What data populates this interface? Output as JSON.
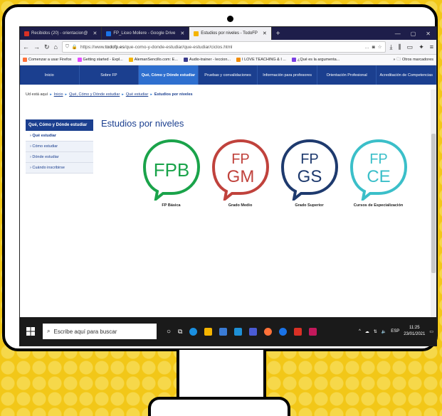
{
  "browser": {
    "tabs": [
      {
        "title": "Recibidos (20) - orientacion@",
        "color": "#d93025",
        "active": false
      },
      {
        "title": "FP_Liceo Moliere - Google Drive",
        "color": "#1a73e8",
        "active": false
      },
      {
        "title": "Estudios por niveles - TodoFP",
        "color": "#f4b400",
        "active": true
      }
    ],
    "new_tab": "+",
    "url_prefix": "https://www.",
    "url_domain": "todofp.es",
    "url_path": "/que-como-y-donde-estudiar/que-estudiar/ciclos.html",
    "url_menu": "…",
    "bookmarks": [
      {
        "label": "Comenzar a usar Firefox",
        "color": "#ff7139"
      },
      {
        "label": "Getting started - Expl...",
        "color": "#e44dff"
      },
      {
        "label": "AlemanSencillo.com: E...",
        "color": "#f4b400"
      },
      {
        "label": "Audio-trainer - leccion...",
        "color": "#3a3a8c"
      },
      {
        "label": "I LOVE TEACHING & I ...",
        "color": "#f28c00"
      },
      {
        "label": "¿Qué es la argumenta...",
        "color": "#7b3fe4"
      }
    ],
    "other_bookmarks": "Otros marcadores"
  },
  "site": {
    "nav": [
      {
        "label": "Inicio",
        "active": false
      },
      {
        "label": "Sobre FP",
        "active": false
      },
      {
        "label": "Qué, Cómo y Dónde estudiar",
        "active": true
      },
      {
        "label": "Pruebas y convalidaciones",
        "active": false
      },
      {
        "label": "Información para profesores",
        "active": false
      },
      {
        "label": "Orientación Profesional",
        "active": false
      },
      {
        "label": "Acreditación de Competencias",
        "active": false
      }
    ],
    "breadcrumb": {
      "prefix": "Ud está aquí",
      "items": [
        "Inicio",
        "Qué, Cómo y Dónde estudiar",
        "Qué estudiar"
      ],
      "current": "Estudios por niveles"
    },
    "sidebar": {
      "heading": "Qué, Cómo y Dónde estudiar",
      "items": [
        "Qué estudiar",
        "Cómo estudiar",
        "Dónde estudiar",
        "Cuándo inscribirse"
      ]
    },
    "title": "Estudios por niveles",
    "levels": [
      {
        "line1": "FPB",
        "line2": "",
        "label": "FP Básica",
        "color": "#1aa34a"
      },
      {
        "line1": "FP",
        "line2": "GM",
        "label": "Grado Medio",
        "color": "#c0423c"
      },
      {
        "line1": "FP",
        "line2": "GS",
        "label": "Grado Superior",
        "color": "#1e3a6e"
      },
      {
        "line1": "FP",
        "line2": "CE",
        "label": "Cursos de Especialización",
        "color": "#3bbfc9"
      }
    ]
  },
  "taskbar": {
    "search_placeholder": "Escribe aquí para buscar",
    "language": "ESP",
    "time": "11:25",
    "date": "23/01/2021"
  }
}
